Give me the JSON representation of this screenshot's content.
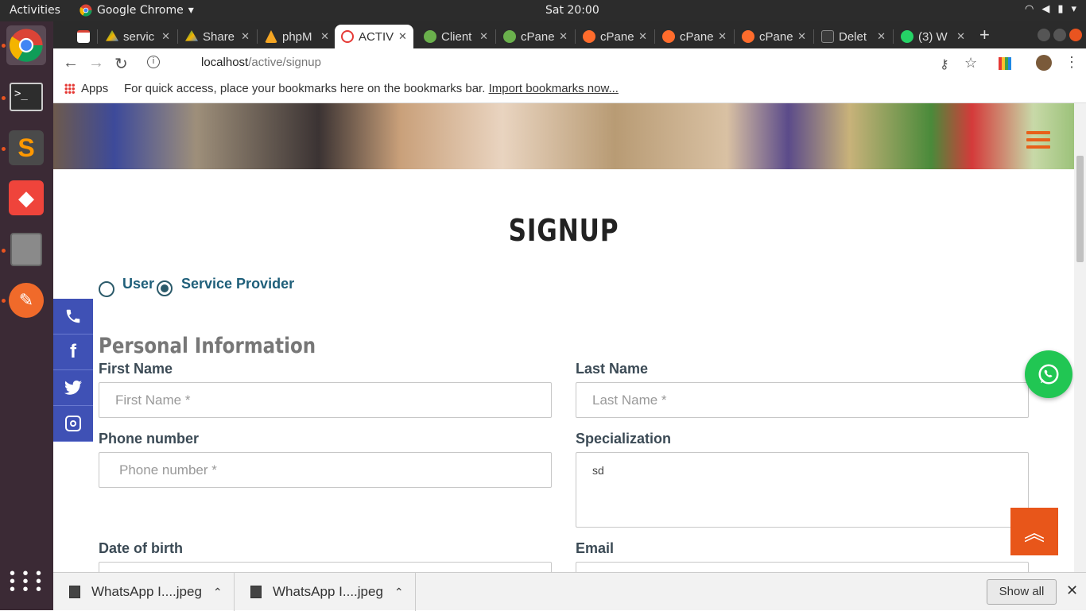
{
  "topbar": {
    "activities": "Activities",
    "app_name": "Google Chrome",
    "clock": "Sat 20:00"
  },
  "tabs": [
    {
      "label": "servic",
      "icon": "google-drive-icon"
    },
    {
      "label": "Share",
      "icon": "google-drive-icon"
    },
    {
      "label": "phpM",
      "icon": "phpmyadmin-icon"
    },
    {
      "label": "ACTIV",
      "icon": "site-favicon",
      "active": true
    },
    {
      "label": "Client",
      "icon": "cpanel-green-icon"
    },
    {
      "label": "cPane",
      "icon": "cpanel-green-icon"
    },
    {
      "label": "cPane",
      "icon": "cpanel-orange-icon"
    },
    {
      "label": "cPane",
      "icon": "cpanel-orange-icon"
    },
    {
      "label": "cPane",
      "icon": "cpanel-orange-icon"
    },
    {
      "label": "Delet",
      "icon": "page-icon"
    },
    {
      "label": "(3) W",
      "icon": "whatsapp-icon"
    }
  ],
  "omnibox": {
    "host": "localhost",
    "path": "/active/signup"
  },
  "bookmarks": {
    "apps": "Apps",
    "hint": "For quick access, place your bookmarks here on the bookmarks bar.",
    "import_link": "Import bookmarks now..."
  },
  "page": {
    "title": "SIGNUP",
    "role_options": [
      {
        "label": "User",
        "checked": false
      },
      {
        "label": "Service Provider",
        "checked": true
      }
    ],
    "section_title": "Personal Information",
    "fields": {
      "first_name": {
        "label": "First Name",
        "placeholder": "First Name *"
      },
      "last_name": {
        "label": "Last Name",
        "placeholder": "Last Name *"
      },
      "phone": {
        "label": "Phone number",
        "placeholder": "Phone number *"
      },
      "specialization": {
        "label": "Specialization",
        "value": "sd"
      },
      "dob": {
        "label": "Date of birth"
      },
      "email": {
        "label": "Email"
      }
    }
  },
  "downloads": {
    "items": [
      "WhatsApp I....jpeg",
      "WhatsApp I....jpeg"
    ],
    "show_all": "Show all"
  }
}
